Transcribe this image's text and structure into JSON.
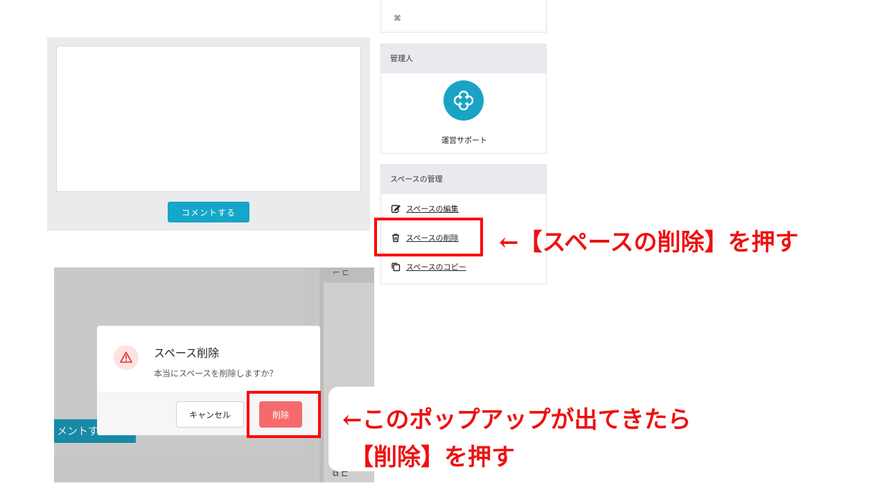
{
  "comment_section": {
    "comment_button_label": "コメントする"
  },
  "admin_card": {
    "heading": "管理人",
    "admin_name": "運営サポート"
  },
  "manage_card": {
    "heading": "スペースの管理",
    "links": [
      {
        "label": "スペースの編集",
        "icon": "edit-icon"
      },
      {
        "label": "スペースの削除",
        "icon": "trash-icon"
      },
      {
        "label": "スペースのコピー",
        "icon": "copy-icon"
      }
    ]
  },
  "dialog": {
    "title": "スペース削除",
    "message": "本当にスペースを削除しますか？",
    "cancel_label": "キャンセル",
    "delete_label": "削除"
  },
  "background": {
    "comment_button_partial": "メントす"
  },
  "annotations": {
    "step1": "←【スペースの削除】を押す",
    "step2_line1": "←このポップアップが出てきたら",
    "step2_line2": "【削除】を押す"
  },
  "colors": {
    "accent": "#16a6c9",
    "danger": "#f56b6b",
    "highlight": "#ff0000",
    "callout_text": "#ee1111"
  }
}
